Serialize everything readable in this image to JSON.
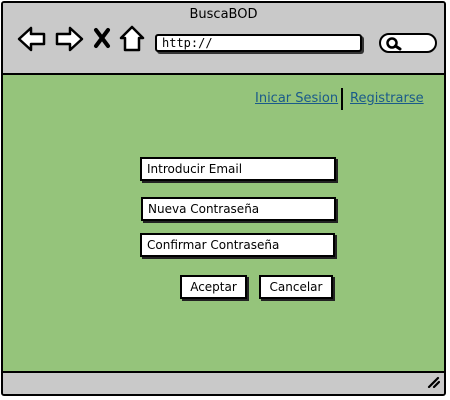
{
  "window": {
    "title": "BuscaBOD"
  },
  "toolbar": {
    "back_icon": "arrow-left-icon",
    "forward_icon": "arrow-right-icon",
    "stop_icon": "close-icon",
    "home_icon": "home-icon",
    "url_value": "http://",
    "search_icon": "search-icon"
  },
  "header_links": {
    "login": "Inicar Sesion",
    "register": "Registrarse"
  },
  "form": {
    "email_field": "Introducir Email",
    "new_password_field": "Nueva Contraseña",
    "confirm_password_field": "Confirmar Contraseña",
    "accept_label": "Aceptar",
    "cancel_label": "Cancelar"
  },
  "colors": {
    "content_background": "#95c47b",
    "chrome_background": "#c9c9c9",
    "link": "#1a5a8a"
  }
}
